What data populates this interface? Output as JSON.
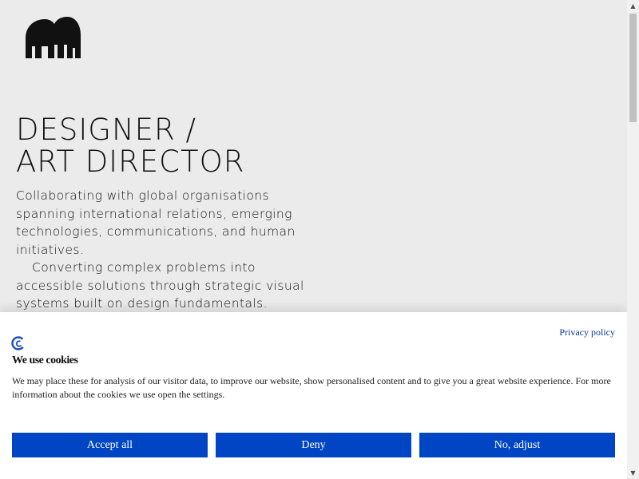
{
  "brand": {
    "logo_icon": "elephant-logo-icon"
  },
  "hero": {
    "title_line_1": "DESIGNER /",
    "title_line_2": "ART DIRECTOR",
    "paragraph_1": "Collaborating with global organisations spanning international relations, emerging technologies, communications, and human initiatives.",
    "paragraph_2": "Converting complex problems into accessible solutions through strategic visual systems built on design fundamentals."
  },
  "cookie_banner": {
    "privacy_link": "Privacy policy",
    "icon": "cookie-consent-icon",
    "title": "We use cookies",
    "description": "We may place these for analysis of our visitor data, to improve our website, show personalised content and to give you a great website experience. For more information about the cookies we use open the settings.",
    "buttons": {
      "accept": "Accept all",
      "deny": "Deny",
      "adjust": "No, adjust"
    },
    "accent_color": "#0045c4"
  },
  "scrollbar": {
    "up_icon": "scroll-up-arrow-icon",
    "down_icon": "scroll-down-arrow-icon"
  }
}
